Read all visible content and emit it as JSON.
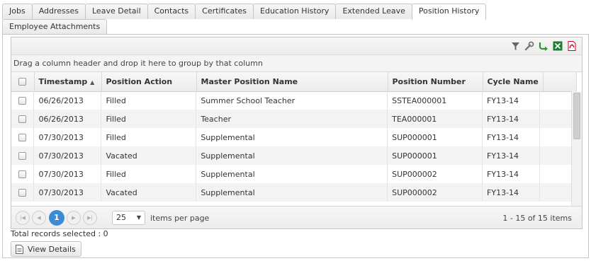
{
  "tabs_row1": [
    "Jobs",
    "Addresses",
    "Leave Detail",
    "Contacts",
    "Certificates",
    "Education History",
    "Extended Leave",
    "Position History"
  ],
  "tabs_row2": [
    "Employee Attachments"
  ],
  "active_tab": "Position History",
  "grid": {
    "group_hint": "Drag a column header and drop it here to group by that column",
    "toolbar_icons": [
      "filter-icon",
      "wrench-icon",
      "export-icon",
      "excel-icon",
      "pdf-icon"
    ],
    "columns": [
      "Timestamp",
      "Position Action",
      "Master Position Name",
      "Position Number",
      "Cycle Name"
    ],
    "sort_indicator": "▲",
    "rows": [
      [
        "06/26/2013",
        "Filled",
        "Summer School Teacher",
        "SSTEA000001",
        "FY13-14"
      ],
      [
        "06/26/2013",
        "Filled",
        "Teacher",
        "TEA000001",
        "FY13-14"
      ],
      [
        "07/30/2013",
        "Filled",
        "Supplemental",
        "SUP000001",
        "FY13-14"
      ],
      [
        "07/30/2013",
        "Vacated",
        "Supplemental",
        "SUP000001",
        "FY13-14"
      ],
      [
        "07/30/2013",
        "Filled",
        "Supplemental",
        "SUP000002",
        "FY13-14"
      ],
      [
        "07/30/2013",
        "Vacated",
        "Supplemental",
        "SUP000002",
        "FY13-14"
      ]
    ]
  },
  "pager": {
    "current_page": "1",
    "page_size": "25",
    "items_per_page_label": "items per page",
    "range_text": "1 - 15 of 15 items"
  },
  "total_selected": "Total records selected : 0",
  "view_details_label": "View Details",
  "colors": {
    "page_active": "#3b8ad3",
    "excel": "#1e7e34",
    "pdf": "#d0021b"
  }
}
